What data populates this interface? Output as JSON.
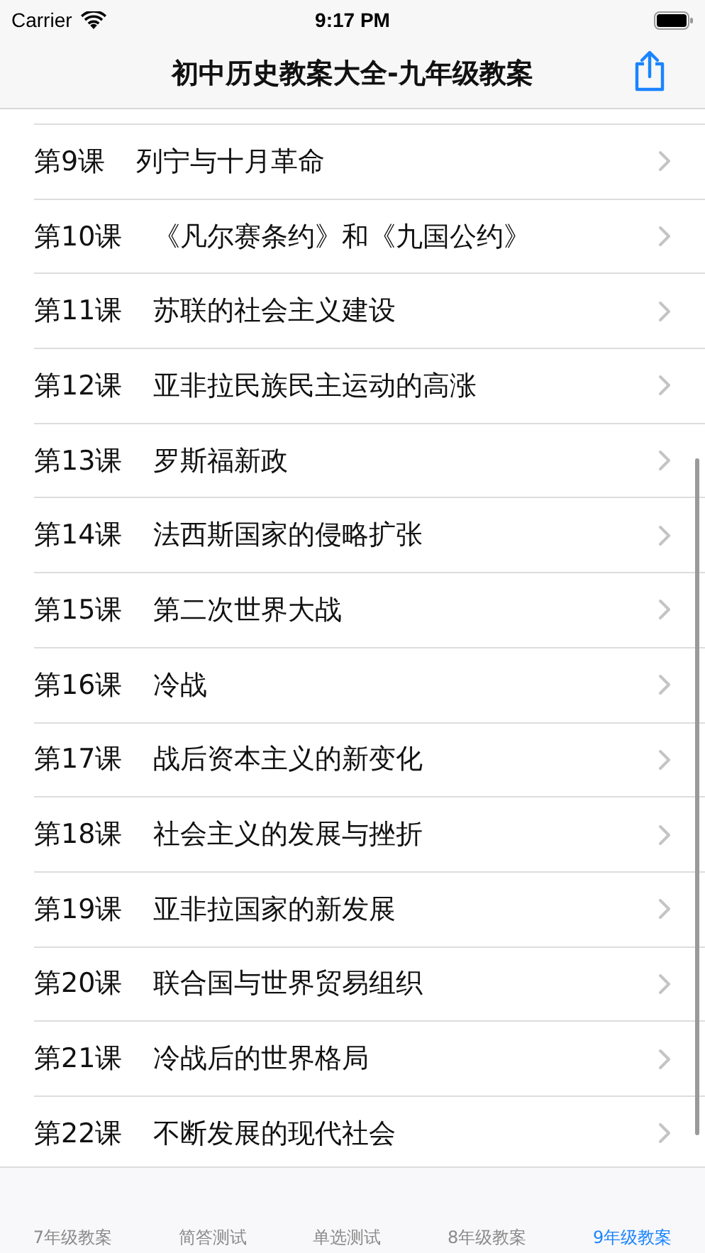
{
  "status_bar": {
    "carrier": "Carrier",
    "time": "9:17 PM"
  },
  "nav_bar": {
    "title": "初中历史教案大全-九年级教案"
  },
  "lessons": [
    {
      "number": "第9课",
      "title": "列宁与十月革命"
    },
    {
      "number": "第10课",
      "title": "《凡尔赛条约》和《九国公约》"
    },
    {
      "number": "第11课",
      "title": "苏联的社会主义建设"
    },
    {
      "number": "第12课",
      "title": "亚非拉民族民主运动的高涨"
    },
    {
      "number": "第13课",
      "title": "罗斯福新政"
    },
    {
      "number": "第14课",
      "title": "法西斯国家的侵略扩张"
    },
    {
      "number": "第15课",
      "title": "第二次世界大战"
    },
    {
      "number": "第16课",
      "title": "冷战"
    },
    {
      "number": "第17课",
      "title": "战后资本主义的新变化"
    },
    {
      "number": "第18课",
      "title": "社会主义的发展与挫折"
    },
    {
      "number": "第19课",
      "title": "亚非拉国家的新发展"
    },
    {
      "number": "第20课",
      "title": "联合国与世界贸易组织"
    },
    {
      "number": "第21课",
      "title": "冷战后的世界格局"
    },
    {
      "number": "第22课",
      "title": "不断发展的现代社会"
    }
  ],
  "tabs": [
    {
      "label": "7年级教案",
      "selected": false
    },
    {
      "label": "简答测试",
      "selected": false
    },
    {
      "label": "单选测试",
      "selected": false
    },
    {
      "label": "8年级教案",
      "selected": false
    },
    {
      "label": "9年级教案",
      "selected": true
    }
  ]
}
